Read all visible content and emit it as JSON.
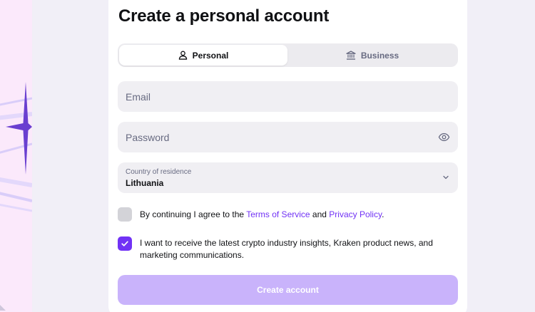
{
  "page": {
    "title": "Create a personal account"
  },
  "tabs": [
    {
      "label": "Personal",
      "icon": "person-icon",
      "active": true
    },
    {
      "label": "Business",
      "icon": "bank-icon",
      "active": false
    }
  ],
  "form": {
    "email": {
      "placeholder": "Email",
      "value": ""
    },
    "password": {
      "placeholder": "Password",
      "value": "",
      "icon": "eye-icon"
    },
    "country": {
      "label": "Country of residence",
      "value": "Lithuania",
      "icon": "chevron-down-icon"
    }
  },
  "consent": {
    "terms": {
      "checked": false,
      "prefix": "By continuing I agree to the ",
      "terms_link": "Terms of Service",
      "middle": " and ",
      "privacy_link": "Privacy Policy",
      "suffix": "."
    },
    "marketing": {
      "checked": true,
      "text": "I want to receive the latest crypto industry insights, Kraken product news, and marketing communications."
    }
  },
  "submit": {
    "label": "Create account"
  },
  "colors": {
    "accent": "#7132f5",
    "button_disabled": "#c9b3fb",
    "field_bg": "#f0eff3",
    "page_bg": "#f1eff7",
    "left_panel_bg": "#fbe9fb"
  }
}
